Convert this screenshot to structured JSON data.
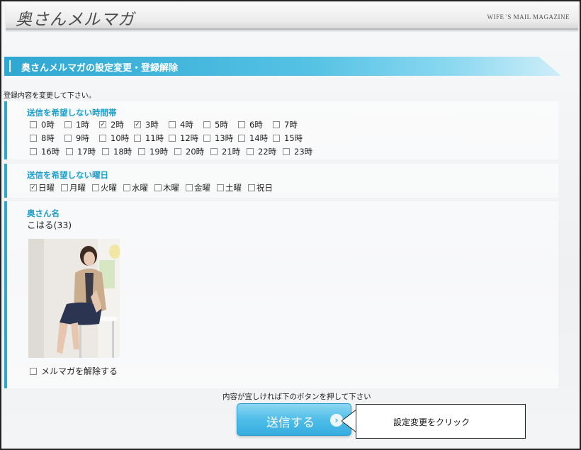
{
  "header": {
    "logo": "奥さんメルマガ",
    "subtitle": "WIFE 'S MAIL MAGAZINE"
  },
  "page_title": "奥さんメルマガの設定変更・登録解除",
  "intro": "登録内容を変更して下さい。",
  "hours_section": {
    "title": "送信を希望しない時間帯",
    "rows": [
      [
        {
          "label": "0時",
          "checked": false
        },
        {
          "label": "1時",
          "checked": false
        },
        {
          "label": "2時",
          "checked": true
        },
        {
          "label": "3時",
          "checked": true
        },
        {
          "label": "4時",
          "checked": false
        },
        {
          "label": "5時",
          "checked": false
        },
        {
          "label": "6時",
          "checked": false
        },
        {
          "label": "7時",
          "checked": false
        }
      ],
      [
        {
          "label": "8時",
          "checked": false
        },
        {
          "label": "9時",
          "checked": false
        },
        {
          "label": "10時",
          "checked": false
        },
        {
          "label": "11時",
          "checked": false
        },
        {
          "label": "12時",
          "checked": false
        },
        {
          "label": "13時",
          "checked": false
        },
        {
          "label": "14時",
          "checked": false
        },
        {
          "label": "15時",
          "checked": false
        }
      ],
      [
        {
          "label": "16時",
          "checked": false
        },
        {
          "label": "17時",
          "checked": false
        },
        {
          "label": "18時",
          "checked": false
        },
        {
          "label": "19時",
          "checked": false
        },
        {
          "label": "20時",
          "checked": false
        },
        {
          "label": "21時",
          "checked": false
        },
        {
          "label": "22時",
          "checked": false
        },
        {
          "label": "23時",
          "checked": false
        }
      ]
    ]
  },
  "days_section": {
    "title": "送信を希望しない曜日",
    "days": [
      {
        "label": "日曜",
        "checked": true
      },
      {
        "label": "月曜",
        "checked": false
      },
      {
        "label": "火曜",
        "checked": false
      },
      {
        "label": "水曜",
        "checked": false
      },
      {
        "label": "木曜",
        "checked": false
      },
      {
        "label": "金曜",
        "checked": false
      },
      {
        "label": "土曜",
        "checked": false
      },
      {
        "label": "祝日",
        "checked": false
      }
    ]
  },
  "profile": {
    "name_title": "奥さん名",
    "name_value": "こはる(33)",
    "unsubscribe_label": "メルマガを解除する",
    "unsubscribe_checked": false
  },
  "footer": {
    "confirm_text": "内容が宜しければ下のボタンを押して下さい",
    "submit_label": "送信する",
    "submit_arrow": "›",
    "callout_text": "設定変更をクリック"
  },
  "colors": {
    "accent": "#2aa7cf",
    "title_text": "#1da0cc",
    "button": "#4fbde8"
  }
}
